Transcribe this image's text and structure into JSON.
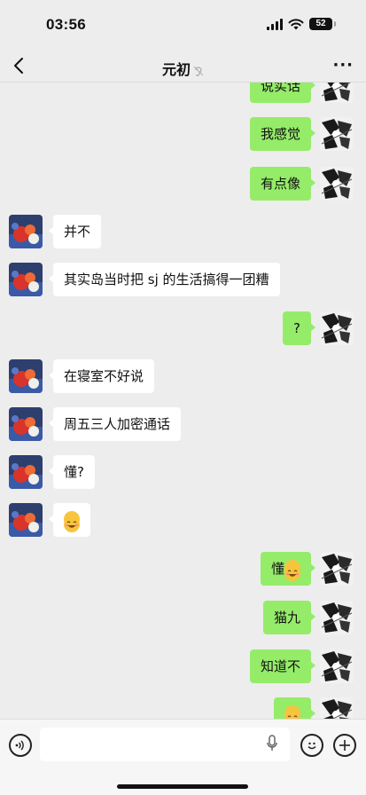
{
  "status_bar": {
    "time": "03:56",
    "battery": "52"
  },
  "nav": {
    "title": "元初"
  },
  "messages": [
    {
      "side": "right",
      "text": "说实话"
    },
    {
      "side": "right",
      "text": "我感觉"
    },
    {
      "side": "right",
      "text": "有点像"
    },
    {
      "side": "left",
      "text": "并不"
    },
    {
      "side": "left",
      "text": "其实岛当时把 sj 的生活搞得一团糟"
    },
    {
      "side": "right",
      "text": "?"
    },
    {
      "side": "left",
      "text": "在寝室不好说"
    },
    {
      "side": "left",
      "text": "周五三人加密通话"
    },
    {
      "side": "left",
      "text": "懂?"
    },
    {
      "side": "left",
      "text": "",
      "emoji": "grinning-face-emoji"
    },
    {
      "side": "right",
      "text": "懂",
      "emoji": "grinning-face-emoji"
    },
    {
      "side": "right",
      "text": "猫九"
    },
    {
      "side": "right",
      "text": "知道不"
    },
    {
      "side": "right",
      "text": "",
      "emoji": "grinning-face-emoji"
    }
  ],
  "icons": {
    "back": "chevron-left-icon",
    "mute": "ear-muted-icon",
    "more": "more-dots-icon",
    "voice": "voice-mode-icon",
    "mic": "microphone-icon",
    "emoji": "smiley-icon",
    "add": "plus-circle-icon"
  },
  "colors": {
    "sent_bubble": "#95ec69",
    "received_bubble": "#ffffff",
    "background": "#ededed"
  }
}
